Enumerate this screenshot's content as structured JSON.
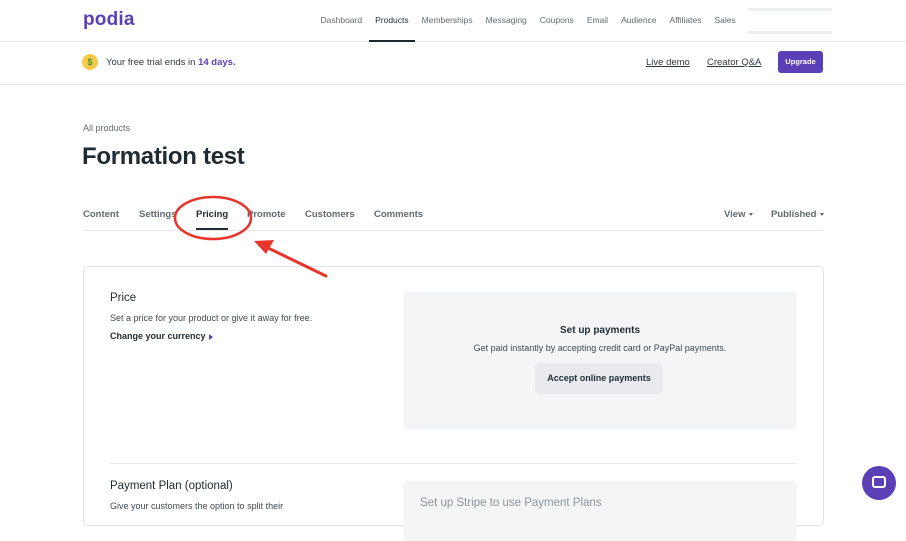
{
  "brand": {
    "logo": "podia"
  },
  "nav": {
    "items": [
      {
        "label": "Dashboard",
        "active": false
      },
      {
        "label": "Products",
        "active": true
      },
      {
        "label": "Memberships",
        "active": false
      },
      {
        "label": "Messaging",
        "active": false
      },
      {
        "label": "Coupons",
        "active": false
      },
      {
        "label": "Email",
        "active": false
      },
      {
        "label": "Audience",
        "active": false
      },
      {
        "label": "Affiliates",
        "active": false
      },
      {
        "label": "Sales",
        "active": false
      }
    ]
  },
  "trial": {
    "emoji_icon": "money-mouth-face-icon",
    "text_before": "Your free trial ends in ",
    "days": "14 days.",
    "live_demo": "Live demo",
    "creator_qa": "Creator Q&A",
    "upgrade": "Upgrade"
  },
  "page": {
    "breadcrumb": "All products",
    "title": "Formation test"
  },
  "tabs": {
    "content": "Content",
    "settings": "Settings",
    "pricing": "Pricing",
    "promote": "Promote",
    "customers": "Customers",
    "comments": "Comments",
    "view": "View",
    "published": "Published",
    "active": "Pricing"
  },
  "price": {
    "title": "Price",
    "description": "Set a price for your product or give it away for free.",
    "currency_link": "Change your currency"
  },
  "payments": {
    "title": "Set up payments",
    "description": "Get paid instantly by accepting credit card or PayPal payments.",
    "button": "Accept online payments"
  },
  "plan": {
    "title": "Payment Plan (optional)",
    "description": "Give your customers the option to split their",
    "stripe_title": "Set up Stripe to use Payment Plans"
  },
  "colors": {
    "brand": "#5b3fb6",
    "annotation": "#e8352b"
  }
}
